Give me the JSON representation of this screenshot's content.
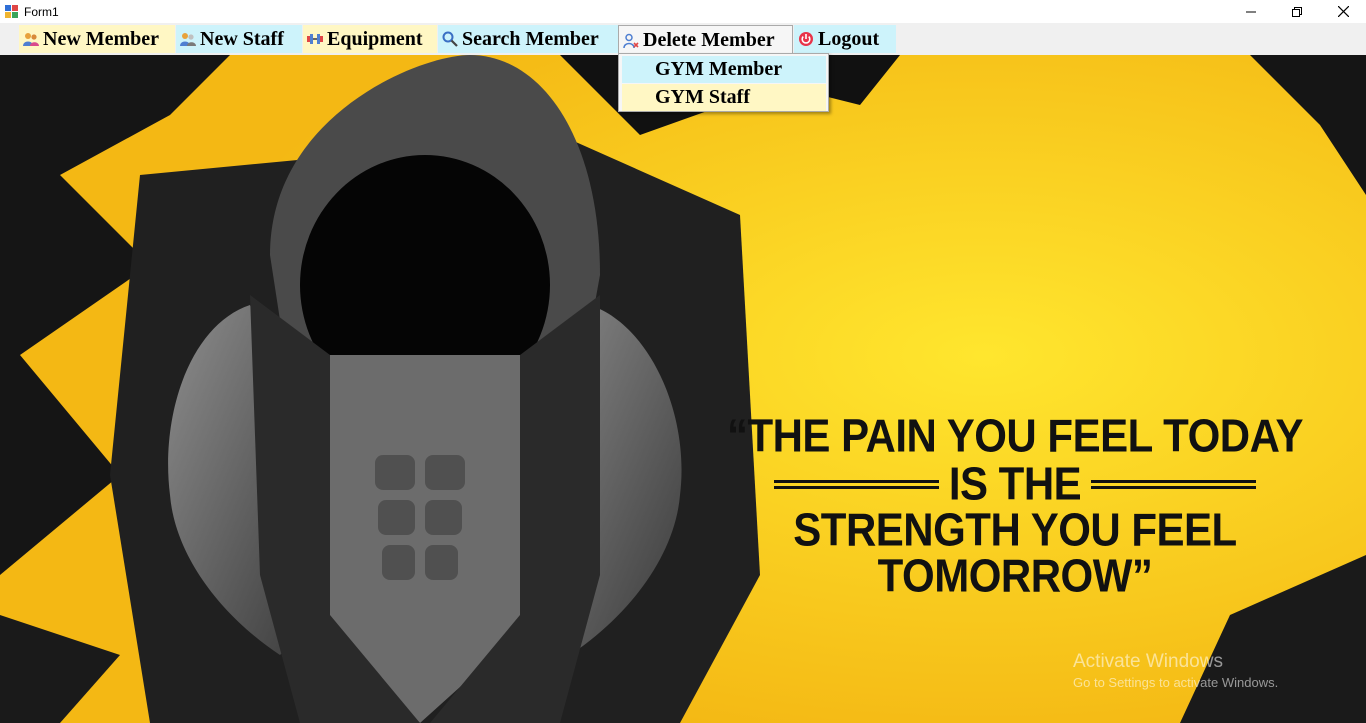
{
  "window": {
    "title": "Form1",
    "controls": [
      "minimize-icon",
      "restore-icon",
      "close-icon"
    ]
  },
  "menu": {
    "items": [
      {
        "label": "New Member",
        "icon": "users-icon",
        "highlight": "#fff7c4"
      },
      {
        "label": "New Staff",
        "icon": "staff-icon",
        "highlight": "#cdf3fb"
      },
      {
        "label": "Equipment",
        "icon": "dumbbell-icon",
        "highlight": "#fff7c4"
      },
      {
        "label": "Search Member",
        "icon": "search-icon",
        "highlight": "#cdf3fb"
      },
      {
        "label": "Delete Member",
        "icon": "delete-user-icon",
        "highlight": "#f6f6f6",
        "open": true
      },
      {
        "label": "Logout",
        "icon": "power-icon",
        "highlight": "#cdf3fb"
      }
    ],
    "delete_dropdown": [
      {
        "label": "GYM Member",
        "highlight": "#cdf3fb"
      },
      {
        "label": "GYM Staff",
        "highlight": "#fff7c4"
      }
    ]
  },
  "poster": {
    "quote_line1": "“THE PAIN YOU FEEL TODAY",
    "quote_line2": "IS THE",
    "quote_line3": "STRENGTH YOU FEEL TOMORROW”",
    "background_color": "#f7c318"
  },
  "watermark": {
    "title": "Activate Windows",
    "subtitle": "Go to Settings to activate Windows."
  }
}
